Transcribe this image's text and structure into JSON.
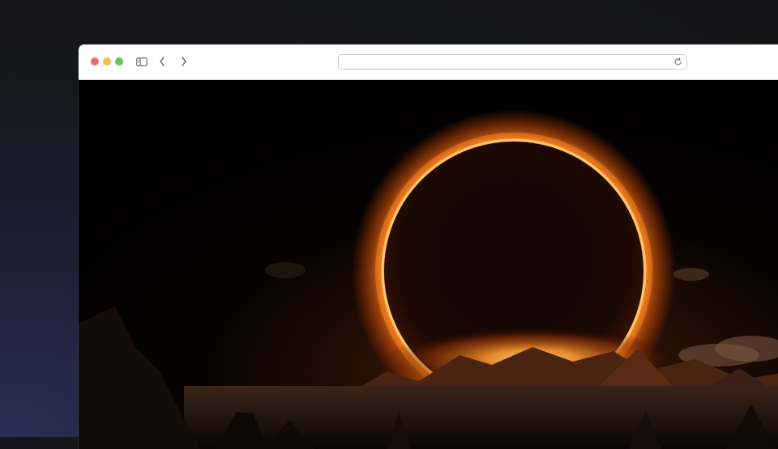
{
  "browser": {
    "window_controls": [
      "close",
      "minimize",
      "zoom"
    ],
    "toolbar_icons": [
      "sidebar-toggle-icon",
      "back-chevron-icon",
      "forward-chevron-icon",
      "reload-icon"
    ],
    "address_bar": {
      "value": "",
      "placeholder": ""
    }
  },
  "page": {
    "image_subject": "solar-eclipse-over-mountains"
  },
  "colors": {
    "close": "#ed6a5e",
    "minimize": "#f5bf4f",
    "zoom": "#61c454",
    "corona": "#ff8a1e",
    "corona_core": "#ffd27a",
    "background": "#000000"
  }
}
